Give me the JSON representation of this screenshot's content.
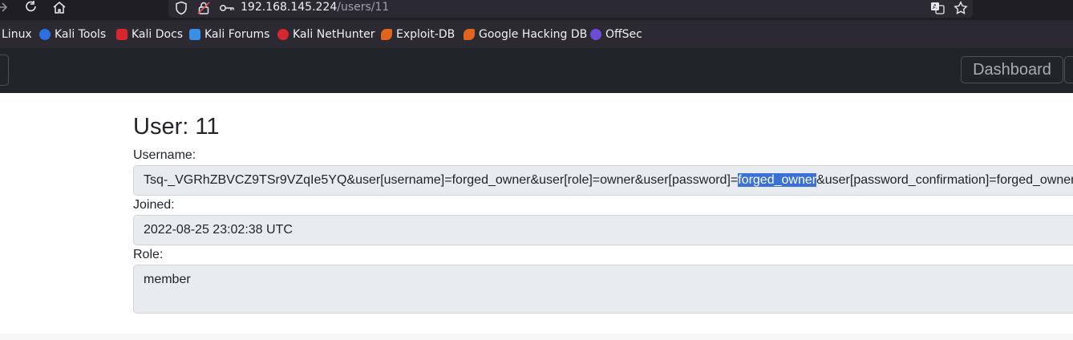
{
  "browser": {
    "url_host": "192.168.145.224",
    "url_path": "/users/11"
  },
  "bookmarks": [
    {
      "label": "Linux",
      "color": ""
    },
    {
      "label": "Kali Tools",
      "color": "#2d6ee0"
    },
    {
      "label": "Kali Docs",
      "color": "#d9262e"
    },
    {
      "label": "Kali Forums",
      "color": "#3a8ee6"
    },
    {
      "label": "Kali NetHunter",
      "color": "#d9262e"
    },
    {
      "label": "Exploit-DB",
      "color": "#e0641e"
    },
    {
      "label": "Google Hacking DB",
      "color": "#e0641e"
    },
    {
      "label": "OffSec",
      "color": "#6a4cd6"
    }
  ],
  "nav": {
    "dashboard_label": "Dashboard"
  },
  "user": {
    "title": "User: 11",
    "username_label": "Username:",
    "username_before": "Tsq-_VGRhZBVCZ9TSr9VZqIe5YQ&user[username]=forged_owner&user[role]=owner&user[password]=",
    "username_selected": "forged_owner",
    "username_after": "&user[password_confirmation]=forged_owner",
    "joined_label": "Joined:",
    "joined_value": "2022-08-25 23:02:38 UTC",
    "role_label": "Role:",
    "role_value": "member"
  },
  "colors": {
    "selection": "#3a70d8",
    "navbar": "#212529",
    "field_bg": "#e9ecef"
  }
}
